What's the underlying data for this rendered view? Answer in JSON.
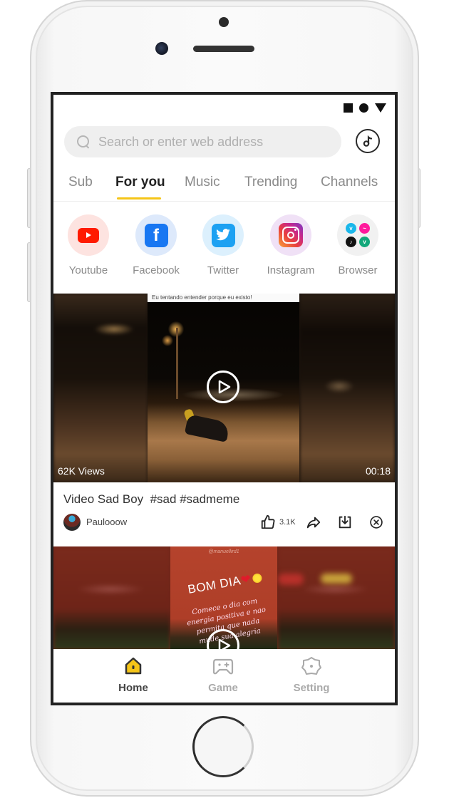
{
  "status_bar": {
    "icons": [
      "square-icon",
      "circle-icon",
      "triangle-icon"
    ]
  },
  "search": {
    "placeholder": "Search or enter web address",
    "value": "",
    "icon": "search-icon",
    "music_button_icon": "music-note-icon"
  },
  "tabs": [
    {
      "label": "Sub",
      "active": false
    },
    {
      "label": "For you",
      "active": true
    },
    {
      "label": "Music",
      "active": false
    },
    {
      "label": "Trending",
      "active": false
    },
    {
      "label": "Channels",
      "active": false
    }
  ],
  "shortcuts": [
    {
      "label": "Youtube",
      "icon": "youtube-icon",
      "bg": "#fde3e0",
      "color": "#ff1a00"
    },
    {
      "label": "Facebook",
      "icon": "facebook-icon",
      "bg": "#dde9fb",
      "color": "#1877f2"
    },
    {
      "label": "Twitter",
      "icon": "twitter-icon",
      "bg": "#dcf0fd",
      "color": "#1da1f2"
    },
    {
      "label": "Instagram",
      "icon": "instagram-icon",
      "bg": "#f0e1f6",
      "color": "#c6268d"
    },
    {
      "label": "Browser",
      "icon": "browser-apps-icon",
      "bg": "#f1f1f1",
      "apps": [
        {
          "glyph": "v",
          "color": "#1ab7ea"
        },
        {
          "glyph": "~",
          "color": "#ff1a9c"
        },
        {
          "glyph": "♪",
          "color": "#111111"
        },
        {
          "glyph": "v",
          "color": "#12a87a"
        }
      ]
    }
  ],
  "videos": [
    {
      "caption_overlay": "Eu tentando entender porque eu existo!",
      "views": "62K Views",
      "duration": "00:18",
      "title": "Video Sad Boy  #sad #sadmeme",
      "author": "Paulooow",
      "likes": "3.1K",
      "actions": [
        "like-icon",
        "share-icon",
        "download-icon",
        "close-icon"
      ]
    },
    {
      "handle_overlay": "@manuellird1",
      "headline": "BOM DIA",
      "script_text": "Comece o dia com energia positiva e nao permita que nada mude sua alegria"
    }
  ],
  "bottom_nav": [
    {
      "label": "Home",
      "icon": "home-icon",
      "active": true
    },
    {
      "label": "Game",
      "icon": "gamepad-icon",
      "active": false
    },
    {
      "label": "Setting",
      "icon": "settings-gear-icon",
      "active": false
    }
  ],
  "colors": {
    "accent": "#f5c518",
    "text_primary": "#222222",
    "text_muted": "#8a8a8a"
  }
}
